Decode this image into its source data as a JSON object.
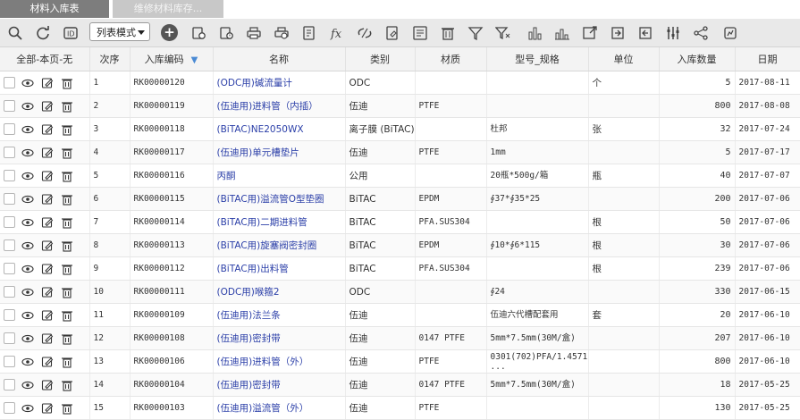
{
  "tabs": [
    {
      "label": "材料入库表",
      "active": true
    },
    {
      "label": "维修材料库存...",
      "active": false
    }
  ],
  "toolbar": {
    "view_mode": "列表模式",
    "icons": [
      "search-icon",
      "refresh-icon",
      "export-icon",
      "add-icon",
      "copy-icon",
      "history-icon",
      "print-icon",
      "print-preview-icon",
      "report-icon",
      "formula-icon",
      "unlink-icon",
      "edit-doc-icon",
      "form-icon",
      "delete-icon",
      "filter-icon",
      "clear-filter-icon",
      "bar-chart-icon",
      "stats-icon",
      "export-out-icon",
      "import-icon",
      "download-icon",
      "column-settings-icon",
      "share-icon",
      "settings-icon"
    ]
  },
  "table": {
    "columns": [
      "全部-本页-无",
      "次序",
      "入库编码",
      "名称",
      "类别",
      "材质",
      "型号_规格",
      "单位",
      "入库数量",
      "日期"
    ],
    "sort_column": "入库编码",
    "rows": [
      {
        "seq": "1",
        "code": "RK00000120",
        "name": "(ODC用)碱流量计",
        "category": "ODC",
        "material": "",
        "spec": "",
        "unit": "个",
        "qty": "5",
        "date": "2017-08-11"
      },
      {
        "seq": "2",
        "code": "RK00000119",
        "name": "(伍迪用)进料管（内插）",
        "category": "伍迪",
        "material": "PTFE",
        "spec": "",
        "unit": "",
        "qty": "800",
        "date": "2017-08-08"
      },
      {
        "seq": "3",
        "code": "RK00000118",
        "name": "(BiTAC)NE2050WX",
        "category": "离子膜 (BiTAC)",
        "material": "",
        "spec": "杜邦",
        "unit": "张",
        "qty": "32",
        "date": "2017-07-24"
      },
      {
        "seq": "4",
        "code": "RK00000117",
        "name": "(伍迪用)单元槽垫片",
        "category": "伍迪",
        "material": "PTFE",
        "spec": "1mm",
        "unit": "",
        "qty": "5",
        "date": "2017-07-17"
      },
      {
        "seq": "5",
        "code": "RK00000116",
        "name": "丙酮",
        "category": "公用",
        "material": "",
        "spec": "20瓶*500g/箱",
        "unit": "瓶",
        "qty": "40",
        "date": "2017-07-07"
      },
      {
        "seq": "6",
        "code": "RK00000115",
        "name": "(BiTAC用)溢流管O型垫圈",
        "category": "BiTAC",
        "material": "EPDM",
        "spec": "∮37*∮35*25",
        "unit": "",
        "qty": "200",
        "date": "2017-07-06"
      },
      {
        "seq": "7",
        "code": "RK00000114",
        "name": "(BiTAC用)二期进料管",
        "category": "BiTAC",
        "material": "PFA.SUS304",
        "spec": "",
        "unit": "根",
        "qty": "50",
        "date": "2017-07-06"
      },
      {
        "seq": "8",
        "code": "RK00000113",
        "name": "(BiTAC用)旋塞阀密封圈",
        "category": "BiTAC",
        "material": "EPDM",
        "spec": "∮10*∮6*115",
        "unit": "根",
        "qty": "30",
        "date": "2017-07-06"
      },
      {
        "seq": "9",
        "code": "RK00000112",
        "name": "(BiTAC用)出料管",
        "category": "BiTAC",
        "material": "PFA.SUS304",
        "spec": "",
        "unit": "根",
        "qty": "239",
        "date": "2017-07-06"
      },
      {
        "seq": "10",
        "code": "RK00000111",
        "name": "(ODC用)喉箍2",
        "category": "ODC",
        "material": "",
        "spec": "∮24",
        "unit": "",
        "qty": "330",
        "date": "2017-06-15"
      },
      {
        "seq": "11",
        "code": "RK00000109",
        "name": "(伍迪用)法兰条",
        "category": "伍迪",
        "material": "",
        "spec": "伍迪六代槽配套用",
        "unit": "套",
        "qty": "20",
        "date": "2017-06-10"
      },
      {
        "seq": "12",
        "code": "RK00000108",
        "name": "(伍迪用)密封带",
        "category": "伍迪",
        "material": "0147 PTFE",
        "spec": "5mm*7.5mm(30M/盒)",
        "unit": "",
        "qty": "207",
        "date": "2017-06-10"
      },
      {
        "seq": "13",
        "code": "RK00000106",
        "name": "(伍迪用)进料管（外）",
        "category": "伍迪",
        "material": "PTFE",
        "spec": "0301(702)PFA/1.4571 ...",
        "unit": "",
        "qty": "800",
        "date": "2017-06-10"
      },
      {
        "seq": "14",
        "code": "RK00000104",
        "name": "(伍迪用)密封带",
        "category": "伍迪",
        "material": "0147 PTFE",
        "spec": "5mm*7.5mm(30M/盒)",
        "unit": "",
        "qty": "18",
        "date": "2017-05-25"
      },
      {
        "seq": "15",
        "code": "RK00000103",
        "name": "(伍迪用)溢流管（外）",
        "category": "伍迪",
        "material": "PTFE",
        "spec": "",
        "unit": "",
        "qty": "130",
        "date": "2017-05-25"
      }
    ]
  },
  "colors": {
    "link": "#2b3fa8",
    "toolbar_bg": "#e9e9e9",
    "tab_active": "#7d7d7d",
    "tab_inactive": "#c8c8c8"
  }
}
